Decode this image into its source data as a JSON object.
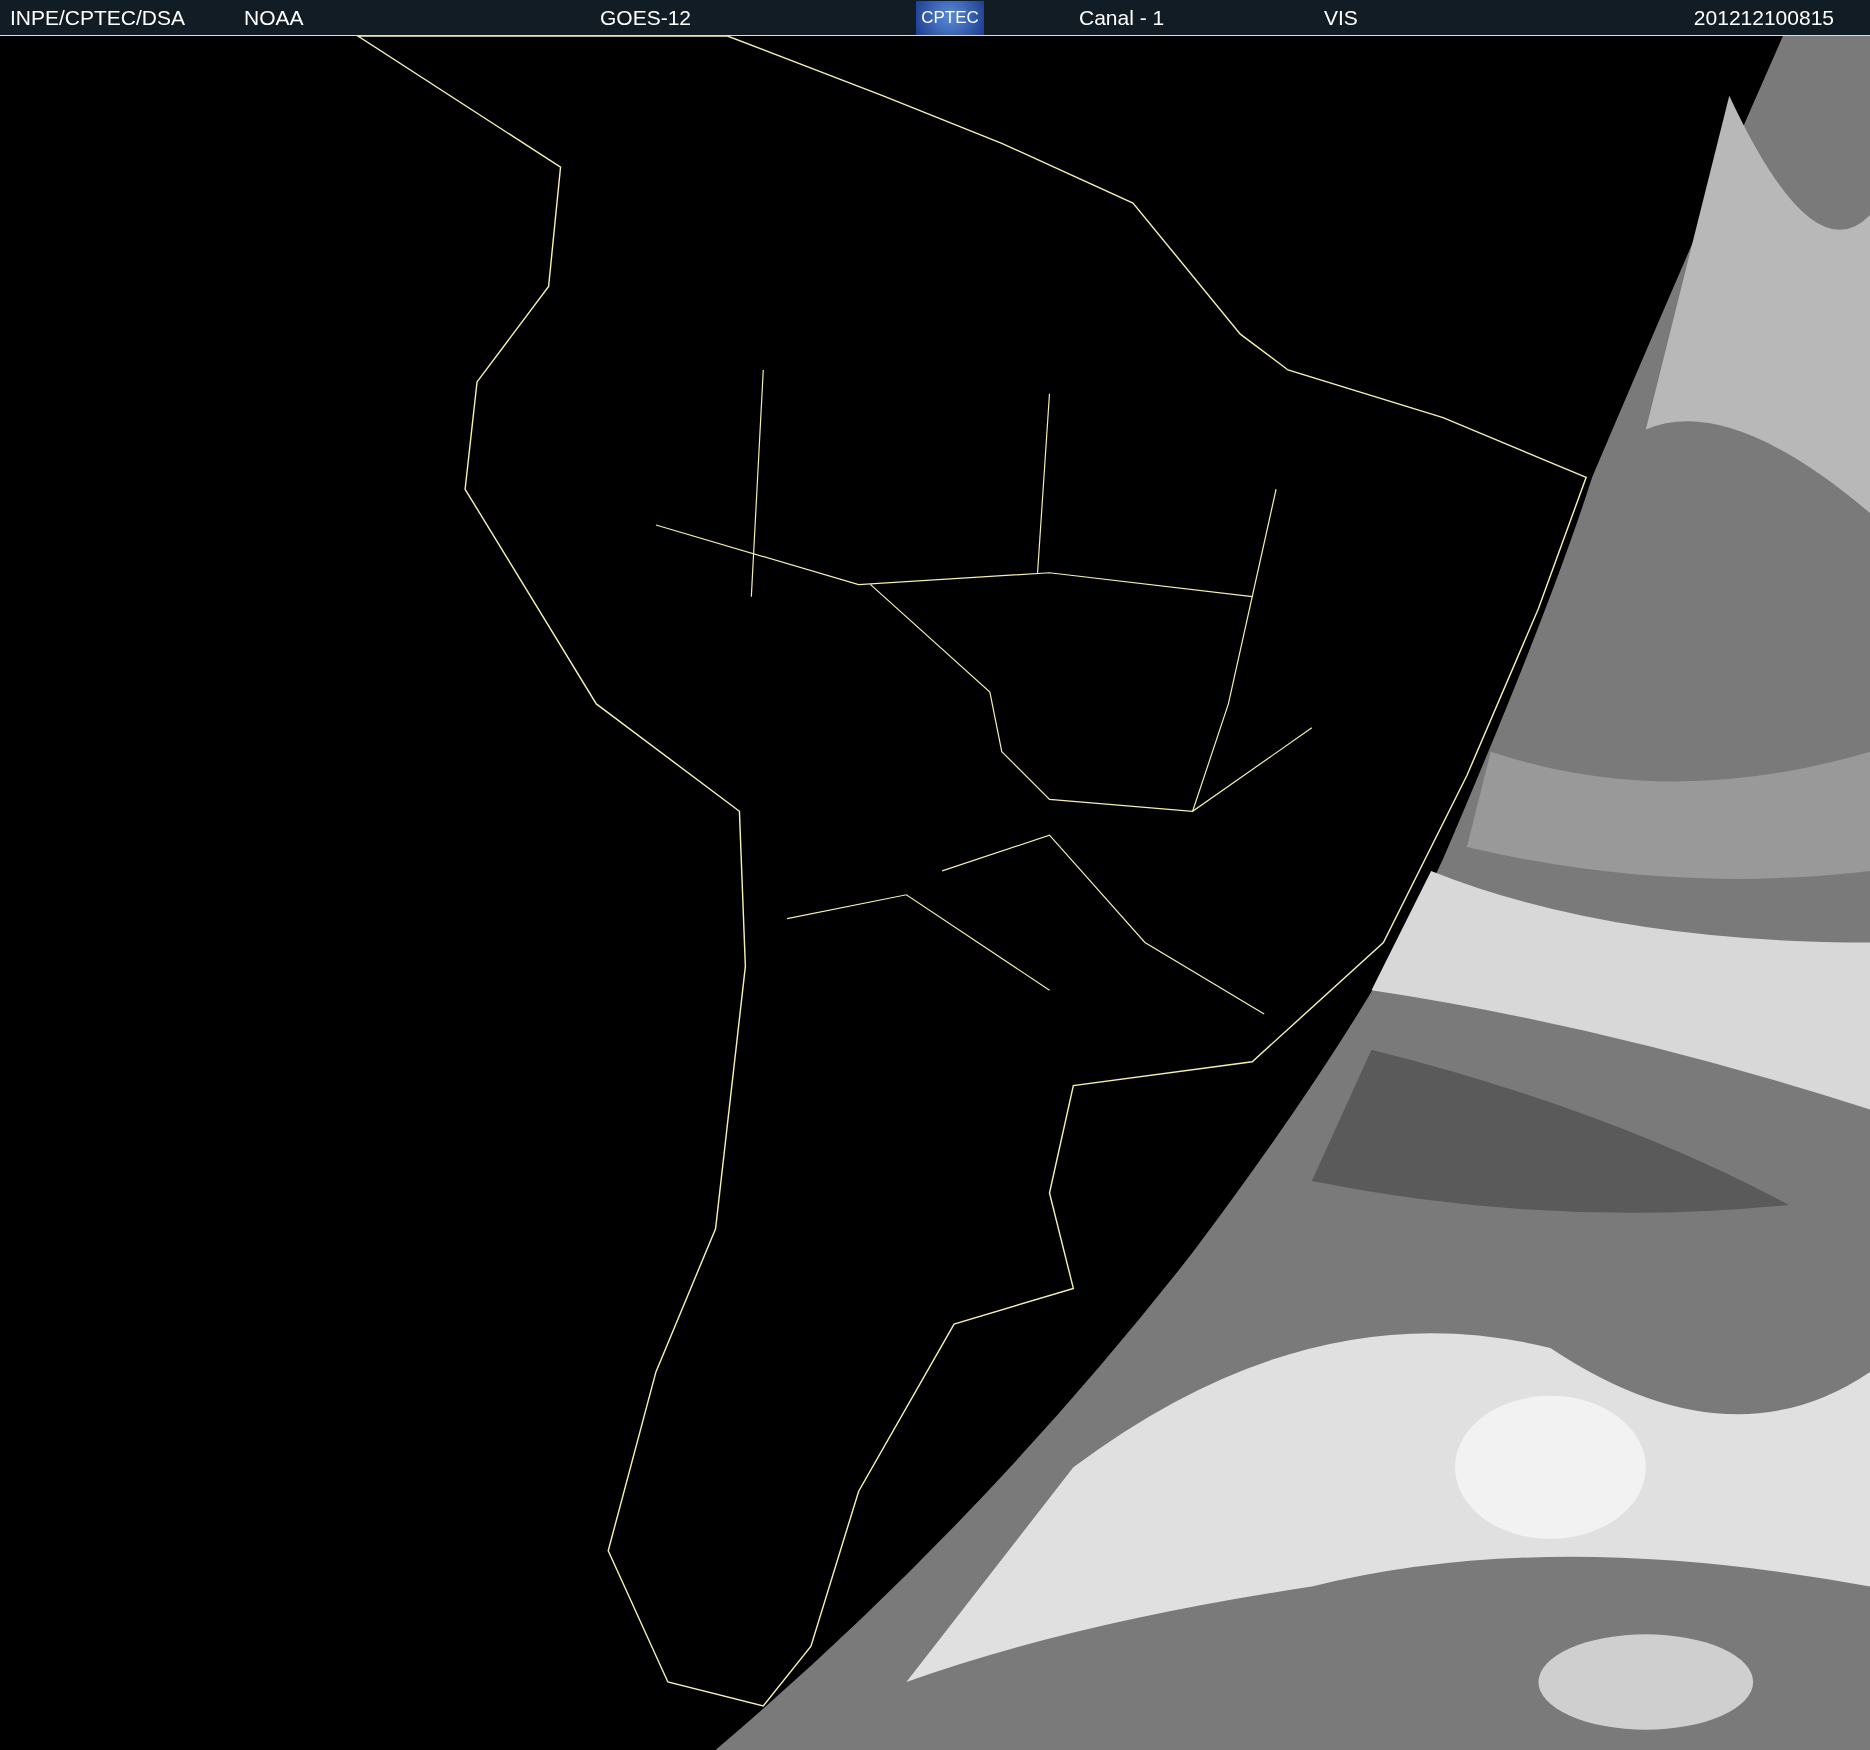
{
  "header": {
    "items": [
      {
        "kind": "text",
        "text": "INPE/CPTEC/DSA"
      },
      {
        "kind": "text",
        "text": "NOAA"
      },
      {
        "kind": "text",
        "text": "GOES-12"
      },
      {
        "kind": "logo",
        "text": "CPTEC"
      },
      {
        "kind": "text",
        "text": "Canal - 1"
      },
      {
        "kind": "text",
        "text": "VIS"
      },
      {
        "kind": "text",
        "text": "201212100815"
      }
    ]
  }
}
